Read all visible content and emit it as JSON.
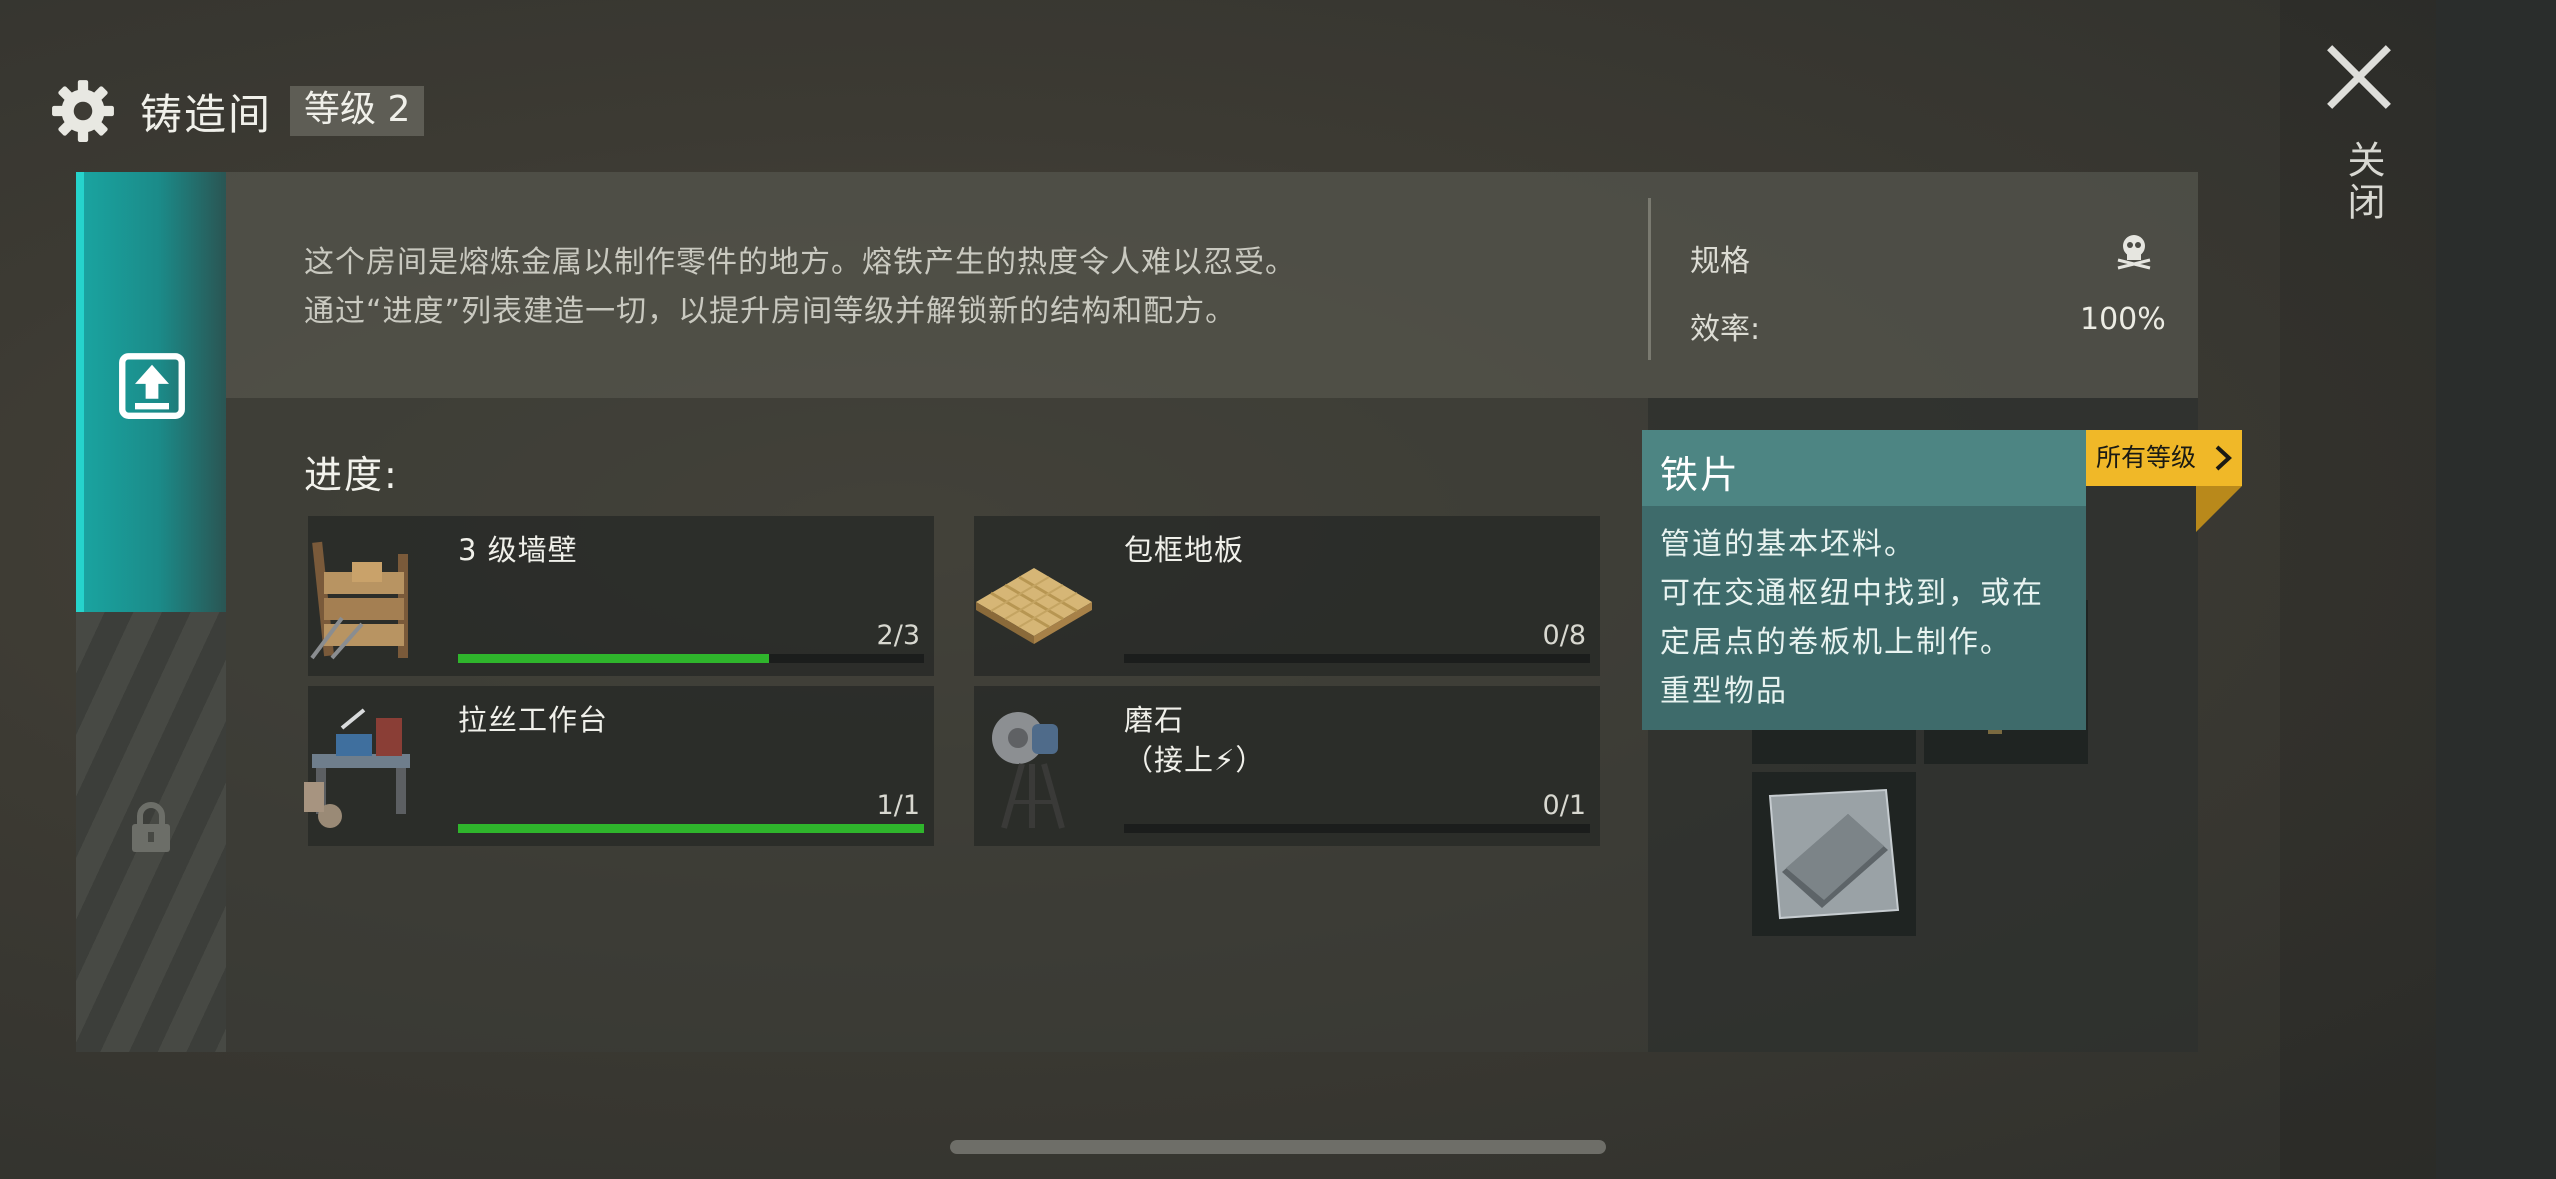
{
  "header": {
    "title": "铸造间",
    "level": "等级 2"
  },
  "close": {
    "label": "关闭"
  },
  "info": {
    "description_lines": [
      "这个房间是熔炼金属以制作零件的地方。熔铁产生的热度令人难以忍受。",
      "通过“进度”列表建造一切，以提升房间等级并解锁新的结构和配方。"
    ],
    "spec_title": "规格",
    "efficiency_label": "效率:",
    "efficiency_value": "100%"
  },
  "progress": {
    "title": "进度:",
    "items": [
      {
        "name": "3 级墙壁",
        "count": "2/3",
        "fraction": 0.667
      },
      {
        "name": "包框地板",
        "count": "0/8",
        "fraction": 0
      },
      {
        "name": "拉丝工作台",
        "count": "1/1",
        "fraction": 1
      },
      {
        "name": "磨石\n（接上⚡）",
        "count": "0/1",
        "fraction": 0
      }
    ]
  },
  "all_levels": {
    "label": "所有等级"
  },
  "tooltip": {
    "title": "铁片",
    "body": "管道的基本坯料。\n可在交通枢纽中找到，或在\n定居点的卷板机上制作。\n重型物品"
  },
  "colors": {
    "accent_teal": "#1aa6a2",
    "progress_green": "#2fb52c",
    "badge_yellow": "#f0b828",
    "tooltip_bg": "#3e6b6b"
  },
  "icons": [
    "gear-icon",
    "close-icon",
    "upgrade-icon",
    "lock-icon",
    "skull-icon",
    "chevron-right-icon"
  ]
}
